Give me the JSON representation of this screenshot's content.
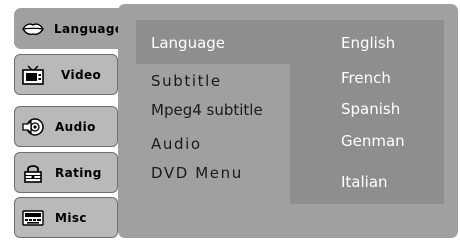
{
  "tabs": [
    {
      "label": "Language",
      "icon": "lips-icon"
    },
    {
      "label": "Video",
      "icon": "tv-icon"
    },
    {
      "label": "Audio",
      "icon": "speaker-icon"
    },
    {
      "label": "Rating",
      "icon": "lock-icon"
    },
    {
      "label": "Misc",
      "icon": "keyboard-icon"
    }
  ],
  "menu": {
    "items": [
      "Language",
      "Subtitle",
      "Mpeg4 subtitle",
      "Audio",
      "DVD Menu"
    ],
    "selected_value": "English",
    "options": [
      "French",
      "Spanish",
      "Genman",
      "Italian"
    ]
  },
  "colors": {
    "panel": "#a0a0a0",
    "highlight": "#8e8e8e",
    "tab": "#b9b9b9",
    "text_light": "#ffffff",
    "text_dark": "#1a1a1a"
  }
}
